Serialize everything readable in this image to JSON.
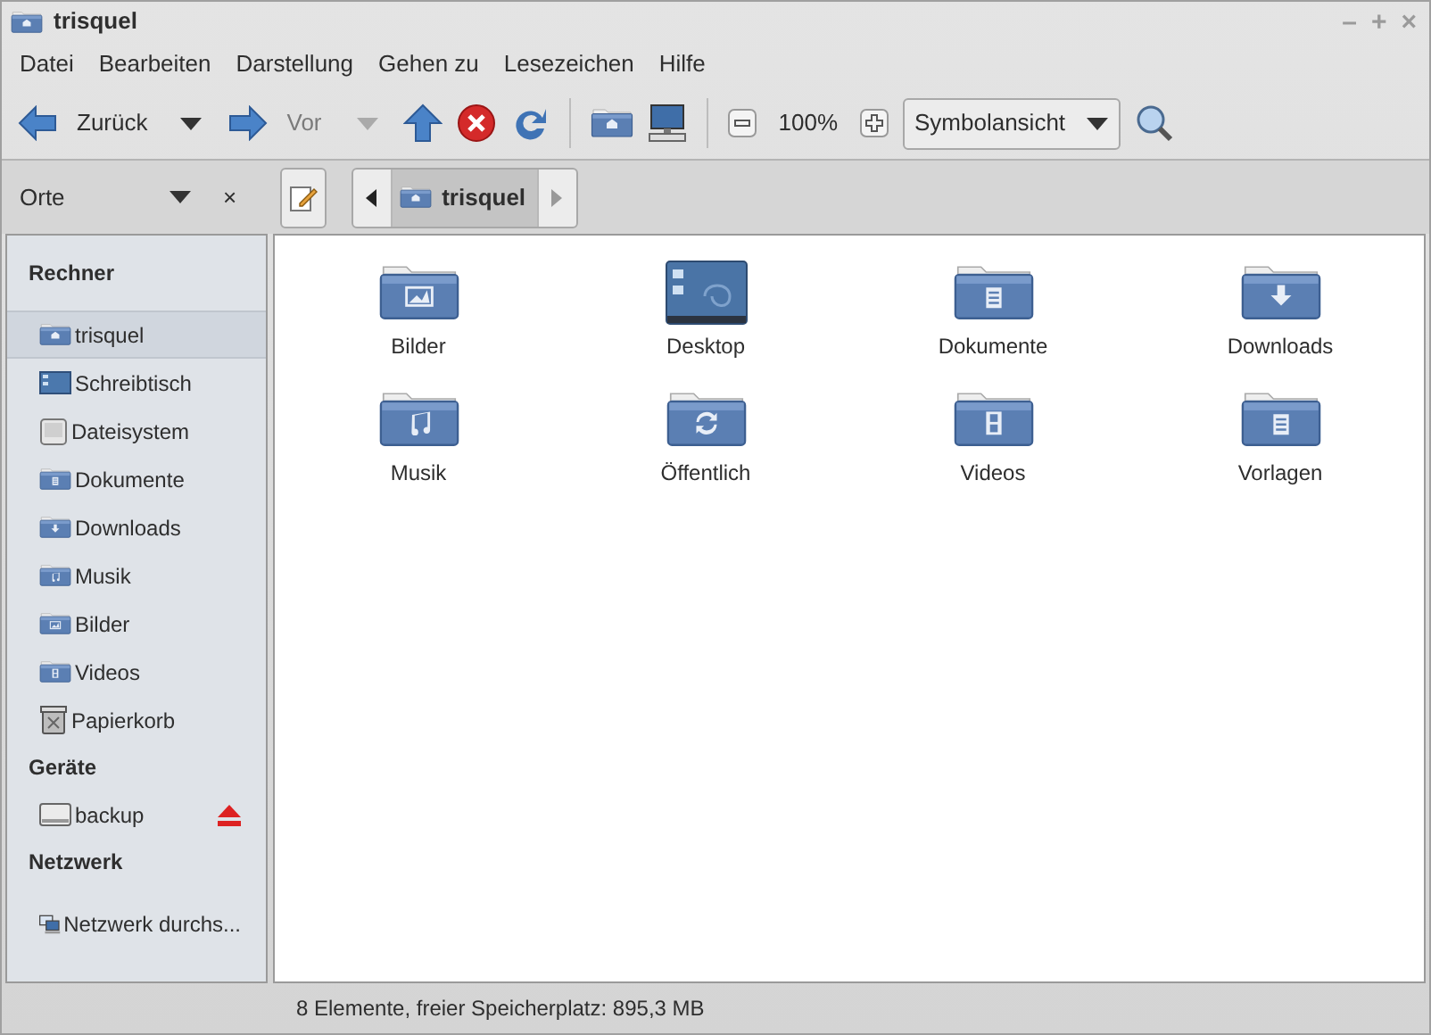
{
  "window": {
    "title": "trisquel",
    "controls": [
      "–",
      "+",
      "×"
    ]
  },
  "menu": [
    "Datei",
    "Bearbeiten",
    "Darstellung",
    "Gehen zu",
    "Lesezeichen",
    "Hilfe"
  ],
  "toolbar": {
    "back": {
      "label": "Zurück",
      "disabled": false
    },
    "forward": {
      "label": "Vor",
      "disabled": true
    },
    "zoom": "100%",
    "view": "Symbolansicht"
  },
  "side_pane": {
    "selector": "Orte",
    "close": "×"
  },
  "path": [
    {
      "label": "trisquel",
      "selected": true
    }
  ],
  "sidebar": [
    {
      "heading": "Rechner",
      "items": [
        {
          "label": "trisquel",
          "kind": "home",
          "selected": true
        },
        {
          "label": "Schreibtisch",
          "kind": "desktop",
          "selected": false
        },
        {
          "label": "Dateisystem",
          "kind": "drive",
          "selected": false
        },
        {
          "label": "Dokumente",
          "kind": "document",
          "selected": false
        },
        {
          "label": "Downloads",
          "kind": "download",
          "selected": false
        },
        {
          "label": "Musik",
          "kind": "music",
          "selected": false
        },
        {
          "label": "Bilder",
          "kind": "image",
          "selected": false
        },
        {
          "label": "Videos",
          "kind": "video",
          "selected": false
        },
        {
          "label": "Papierkorb",
          "kind": "trash",
          "selected": false
        }
      ]
    },
    {
      "heading": "Geräte",
      "items": [
        {
          "label": "backup",
          "kind": "disk",
          "selected": false,
          "ejectable": true
        }
      ]
    },
    {
      "heading": "Netzwerk",
      "items": [
        {
          "label": "Netzwerk durchs...",
          "kind": "network",
          "selected": false
        }
      ]
    }
  ],
  "files": [
    {
      "name": "Bilder",
      "kind": "image"
    },
    {
      "name": "Desktop",
      "kind": "desktop"
    },
    {
      "name": "Dokumente",
      "kind": "document"
    },
    {
      "name": "Downloads",
      "kind": "download"
    },
    {
      "name": "Musik",
      "kind": "music"
    },
    {
      "name": "Öffentlich",
      "kind": "share"
    },
    {
      "name": "Videos",
      "kind": "video"
    },
    {
      "name": "Vorlagen",
      "kind": "template"
    }
  ],
  "status_bar": "8 Elemente, freier Speicherplatz: 895,3 MB"
}
